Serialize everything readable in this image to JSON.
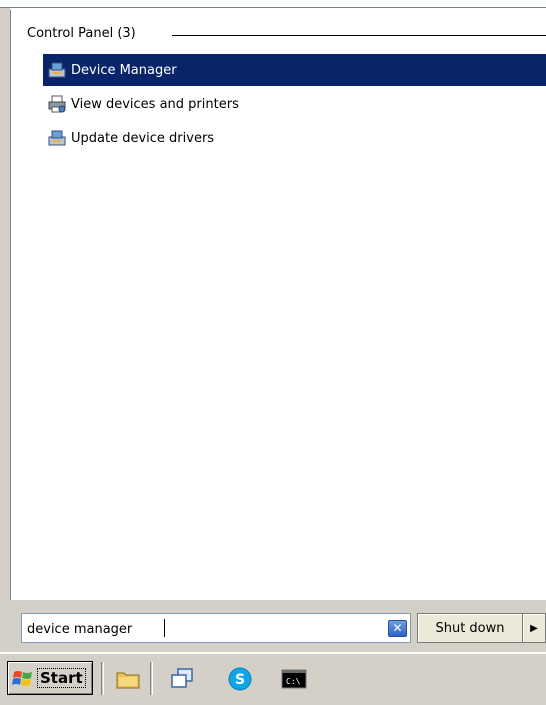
{
  "results": {
    "group_title": "Control Panel (3)",
    "items": [
      {
        "label": "Device Manager",
        "icon": "device-manager-icon",
        "selected": true
      },
      {
        "label": "View devices and printers",
        "icon": "printer-icon",
        "selected": false
      },
      {
        "label": "Update device drivers",
        "icon": "device-driver-icon",
        "selected": false
      }
    ]
  },
  "search": {
    "value": "device manager",
    "clear_icon": "clear-icon"
  },
  "shutdown": {
    "label": "Shut down",
    "arrow_icon": "right-arrow-icon"
  },
  "taskbar": {
    "start_label": "Start",
    "quick_launch": [
      {
        "icon": "folder-icon"
      },
      {
        "icon": "desktop-switch-icon"
      },
      {
        "icon": "skype-icon"
      },
      {
        "icon": "command-prompt-icon"
      }
    ]
  },
  "colors": {
    "selection": "#0a246a",
    "chrome": "#d4d0c8"
  }
}
